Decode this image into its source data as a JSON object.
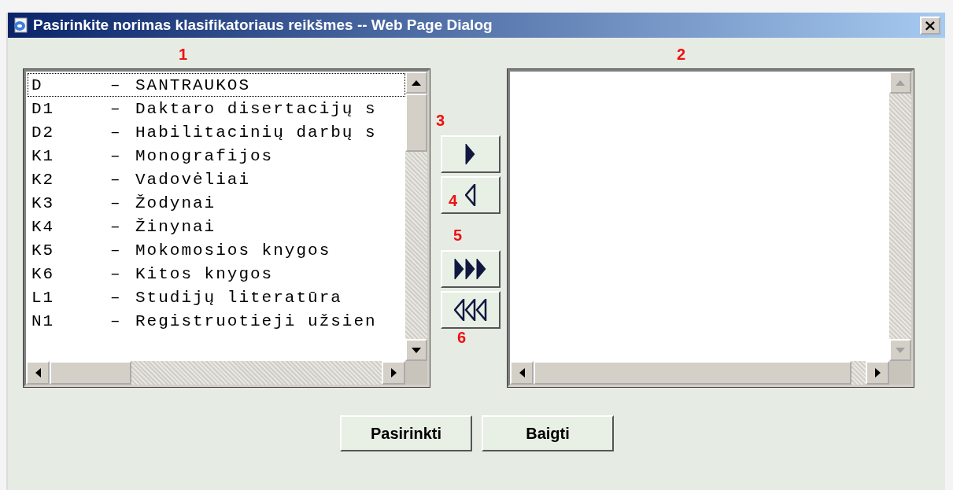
{
  "window": {
    "title": "Pasirinkite norimas klasifikatoriaus reikšmes -- Web Page Dialog",
    "close": "×"
  },
  "markers": [
    "1",
    "2",
    "3",
    "4",
    "5",
    "6"
  ],
  "available_list": {
    "items": [
      {
        "code": "D",
        "dash": "–",
        "name": "SANTRAUKOS",
        "selected": true
      },
      {
        "code": "D1",
        "dash": "–",
        "name": "Daktaro disertacijų s",
        "selected": false
      },
      {
        "code": "D2",
        "dash": "–",
        "name": "Habilitacinių darbų s",
        "selected": false
      },
      {
        "code": "K1",
        "dash": "–",
        "name": "Monografijos",
        "selected": false
      },
      {
        "code": "K2",
        "dash": "–",
        "name": "Vadovėliai",
        "selected": false
      },
      {
        "code": "K3",
        "dash": "–",
        "name": "Žodynai",
        "selected": false
      },
      {
        "code": "K4",
        "dash": "–",
        "name": "Žinynai",
        "selected": false
      },
      {
        "code": "K5",
        "dash": "–",
        "name": "Mokomosios knygos",
        "selected": false
      },
      {
        "code": "K6",
        "dash": "–",
        "name": "Kitos knygos",
        "selected": false
      },
      {
        "code": "L1",
        "dash": "–",
        "name": "Studijų literatūra",
        "selected": false
      },
      {
        "code": "N1",
        "dash": "–",
        "name": "Registruotieji užsien",
        "selected": false
      }
    ]
  },
  "transfer_buttons": [
    {
      "kind": "add"
    },
    {
      "kind": "remove"
    },
    {
      "kind": "add_all"
    },
    {
      "kind": "remove_all"
    }
  ],
  "buttons": [
    "Pasirinkti",
    "Baigti"
  ]
}
